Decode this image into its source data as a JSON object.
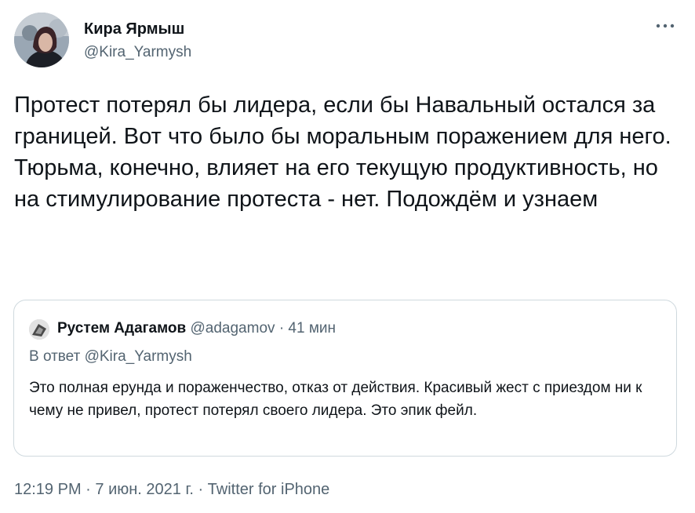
{
  "tweet": {
    "author_name": "Кира Ярмыш",
    "author_handle": "@Kira_Yarmysh",
    "more_menu_icon": "more-horizontal-icon",
    "text": "Протест потерял бы лидера, если бы Навальный остался за границей. Вот что было бы моральным поражением для него. Тюрьма, конечно, влияет на его текущую продуктивность, но на стимулирование протеста - нет. Подождём и узнаем",
    "time": "12:19 PM",
    "date": "7 июн. 2021 г.",
    "source": "Twitter for iPhone",
    "separator": "·"
  },
  "quoted_tweet": {
    "author_name": "Рустем Адагамов",
    "author_handle": "@adagamov",
    "age": "41 мин",
    "separator": "·",
    "reply_to": "В ответ @Kira_Yarmysh",
    "text": "Это полная ерунда и пораженчество, отказ от действия. Красивый жест с приездом ни к чему не привел, протест потерял своего лидера. Это эпик фейл."
  },
  "colors": {
    "text_primary": "#0f1419",
    "text_secondary": "#536471",
    "border": "#cfd9de",
    "background": "#ffffff"
  }
}
